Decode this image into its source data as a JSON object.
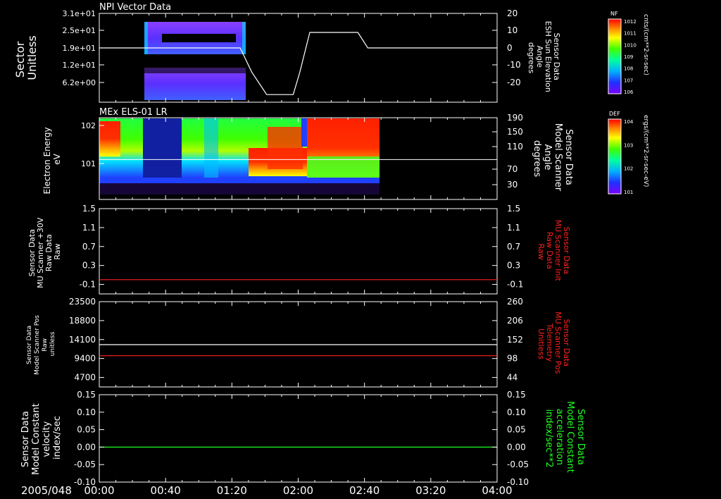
{
  "date_label": "2005/048",
  "time_ticks": [
    "00:00",
    "00:40",
    "01:20",
    "02:00",
    "02:40",
    "03:20",
    "04:00"
  ],
  "colors": {
    "white": "#ffffff",
    "red": "#ff2020",
    "green": "#20ff20"
  },
  "chart_data": [
    {
      "type": "heatmap",
      "title": "NPI Vector Data",
      "ylabel": [
        "Sector",
        "Unitless"
      ],
      "yticks": [
        "3.1e+01",
        "2.5e+01",
        "1.9e+01",
        "1.2e+01",
        "6.2e+00"
      ],
      "y2label": [
        "Sensor Data",
        "ESH Sun Elevation",
        "Angle",
        "degrees"
      ],
      "y2ticks": [
        "20",
        "10",
        "0",
        "-10",
        "-20"
      ],
      "y2lim": [
        -30,
        20
      ],
      "data_span": [
        "00:15",
        "01:24"
      ],
      "overlay_line": {
        "name": "Sun Elevation Angle",
        "x": [
          "00:00",
          "01:25",
          "01:32",
          "01:41",
          "01:57",
          "02:01",
          "02:07",
          "02:36",
          "02:42",
          "04:00"
        ],
        "y": [
          0,
          0,
          -14,
          -27,
          -27,
          -14,
          9,
          9,
          0,
          0
        ]
      },
      "colorbar": {
        "label": "NF",
        "units": "cnts/(cm**2-sr-sec)",
        "ticks": [
          "10^12",
          "10^11",
          "10^10",
          "10^9",
          "10^8",
          "10^7",
          "10^6"
        ]
      }
    },
    {
      "type": "heatmap",
      "title": "MEx ELS-01 LR",
      "ylabel": [
        "Electron Energy",
        "eV"
      ],
      "yticks": [
        "10^2",
        "10^1"
      ],
      "y2label": [
        "Sensor Data",
        "Model Scanner",
        "Angle",
        "degrees"
      ],
      "y2ticks": [
        "190",
        "150",
        "110",
        "70",
        "30"
      ],
      "y2lim": [
        0,
        190
      ],
      "data_span": [
        "00:00",
        "02:46"
      ],
      "overlay_line": {
        "name": "Scanner Angle",
        "x": [
          "00:00",
          "04:00"
        ],
        "y": [
          90,
          90
        ]
      },
      "colorbar": {
        "label": "DEF",
        "units": "ergs/(cm**2-sr-sec-eV)",
        "ticks": [
          "10^4",
          "10^3",
          "10^2",
          "10^1"
        ]
      }
    },
    {
      "type": "line",
      "ylabel": [
        "Sensor Data",
        "MU Scanner +30V",
        "Raw Data",
        "Raw"
      ],
      "yticks": [
        "1.5",
        "1.1",
        "0.7",
        "0.3",
        "-0.1"
      ],
      "ylim": [
        -0.3,
        1.5
      ],
      "y2label": [
        "Sensor Data",
        "MU Scanner Init",
        "Raw Data",
        "Raw"
      ],
      "y2ticks": [
        "1.5",
        "1.1",
        "0.7",
        "0.3",
        "-0.1"
      ],
      "series": [
        {
          "color": "#ff2020",
          "x": [
            "00:00",
            "04:00"
          ],
          "y": [
            0.0,
            0.0
          ]
        }
      ]
    },
    {
      "type": "line",
      "ylabel": [
        "Sensor Data",
        "Model Scanner Pos",
        "Raw",
        "unitless"
      ],
      "yticks": [
        "23500",
        "18800",
        "14100",
        "9400",
        "4700"
      ],
      "ylim": [
        0,
        23500
      ],
      "y2label": [
        "Sensor Data",
        "MU Scanner Pos",
        "Telemetry",
        "Unitless"
      ],
      "y2ticks": [
        "260",
        "206",
        "152",
        "98",
        "44"
      ],
      "y2lim": [
        -10,
        260
      ],
      "series": [
        {
          "color": "#ffffff",
          "x": [
            "00:00",
            "04:00"
          ],
          "y": [
            11650,
            11650
          ]
        },
        {
          "color": "#ff2020",
          "x": [
            "00:00",
            "04:00"
          ],
          "y": [
            8600,
            8600
          ]
        }
      ]
    },
    {
      "type": "line",
      "ylabel": [
        "Sensor Data",
        "Model Constant",
        "velocity",
        "index/sec"
      ],
      "yticks": [
        "0.15",
        "0.10",
        "0.05",
        "0.00",
        "-0.05",
        "-0.10"
      ],
      "ylim": [
        -0.1,
        0.15
      ],
      "y2label": [
        "Sensor Data",
        "Model Constant",
        "acceleration",
        "index/sec**2"
      ],
      "y2ticks": [
        "0.15",
        "0.10",
        "0.05",
        "0.00",
        "-0.05",
        "-0.10"
      ],
      "series": [
        {
          "color": "#20ff20",
          "x": [
            "00:00",
            "04:00"
          ],
          "y": [
            0.0,
            0.0
          ]
        }
      ]
    }
  ]
}
